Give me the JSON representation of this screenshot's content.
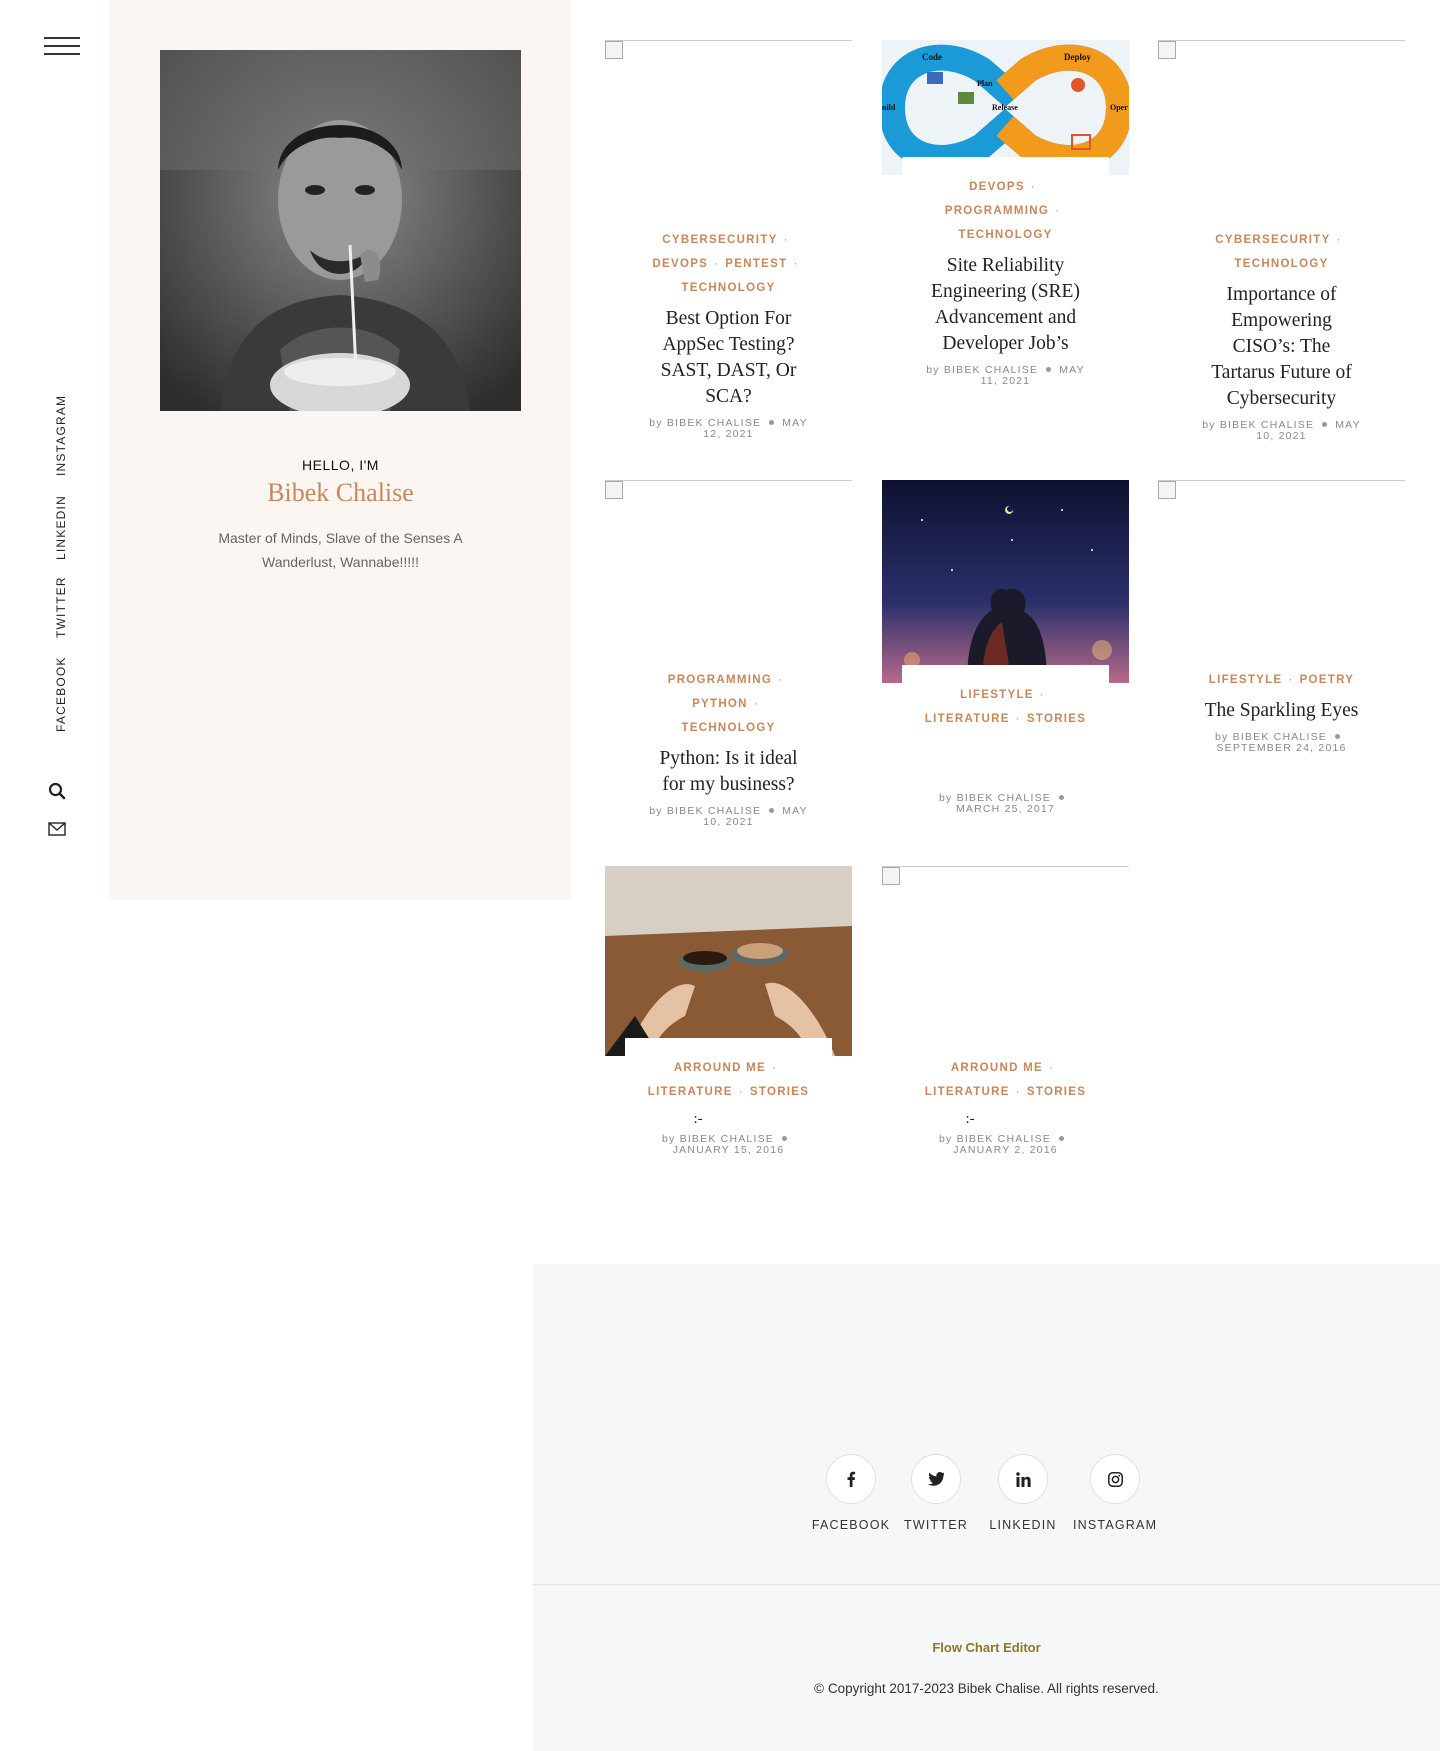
{
  "rail": {
    "social": [
      "INSTAGRAM",
      "LINKEDIN",
      "TWITTER",
      "FACEBOOK"
    ]
  },
  "profile": {
    "greeting": "HELLO, I'M",
    "name": "Bibek Chalise",
    "bio": "Master of Minds, Slave of the Senses A Wanderlust, Wannabe!!!!!"
  },
  "posts": [
    {
      "categories": [
        "CYBERSECURITY",
        "DEVOPS",
        "PENTEST",
        "TECHNOLOGY"
      ],
      "title": "Best Option For AppSec Testing? SAST, DAST, Or SCA?",
      "by": "by",
      "author": "BIBEK CHALISE",
      "date": "MAY 12, 2021"
    },
    {
      "categories": [
        "DEVOPS",
        "PROGRAMMING",
        "TECHNOLOGY"
      ],
      "title": "Site Reliability Engineering (SRE) Advancement and Developer Job’s",
      "by": "by",
      "author": "BIBEK CHALISE",
      "date": "MAY 11, 2021",
      "image_labels": [
        "Code",
        "Deploy",
        "Plan",
        "Release",
        "uild",
        "Oper"
      ]
    },
    {
      "categories": [
        "CYBERSECURITY",
        "TECHNOLOGY"
      ],
      "title": "Importance of Empowering CISO’s: The Tartarus Future of Cybersecurity",
      "by": "by",
      "author": "BIBEK CHALISE",
      "date": "MAY 10, 2021"
    },
    {
      "categories": [
        "PROGRAMMING",
        "PYTHON",
        "TECHNOLOGY"
      ],
      "title": "Python: Is it ideal for my business?",
      "by": "by",
      "author": "BIBEK CHALISE",
      "date": "MAY 10, 2021"
    },
    {
      "categories": [
        "LIFESTYLE",
        "LITERATURE",
        "STORIES"
      ],
      "title": "",
      "by": "by",
      "author": "BIBEK CHALISE",
      "date": "MARCH 25, 2017"
    },
    {
      "categories": [
        "LIFESTYLE",
        "POETRY"
      ],
      "title": "The Sparkling Eyes",
      "by": "by",
      "author": "BIBEK CHALISE",
      "date": "SEPTEMBER 24, 2016"
    },
    {
      "categories": [
        "ARROUND ME",
        "LITERATURE",
        "STORIES"
      ],
      "title": ":-",
      "by": "by",
      "author": "BIBEK CHALISE",
      "date": "JANUARY 15, 2016"
    },
    {
      "categories": [
        "ARROUND ME",
        "LITERATURE",
        "STORIES"
      ],
      "title": ":-",
      "by": "by",
      "author": "BIBEK CHALISE",
      "date": "JANUARY 2, 2016"
    }
  ],
  "footer": {
    "social": [
      "FACEBOOK",
      "TWITTER",
      "LINKEDIN",
      "INSTAGRAM"
    ],
    "link": "Flow Chart Editor",
    "copyright": "© Copyright 2017-2023 Bibek Chalise. All rights reserved."
  },
  "colors": {
    "accent": "#c8865a",
    "panel": "#fbf6f2",
    "footer_bg": "#f6f7f9",
    "footer_link": "#8a7a25"
  },
  "icons": [
    "menu-icon",
    "search-icon",
    "envelope-icon",
    "facebook-icon",
    "twitter-icon",
    "linkedin-icon",
    "instagram-icon"
  ]
}
